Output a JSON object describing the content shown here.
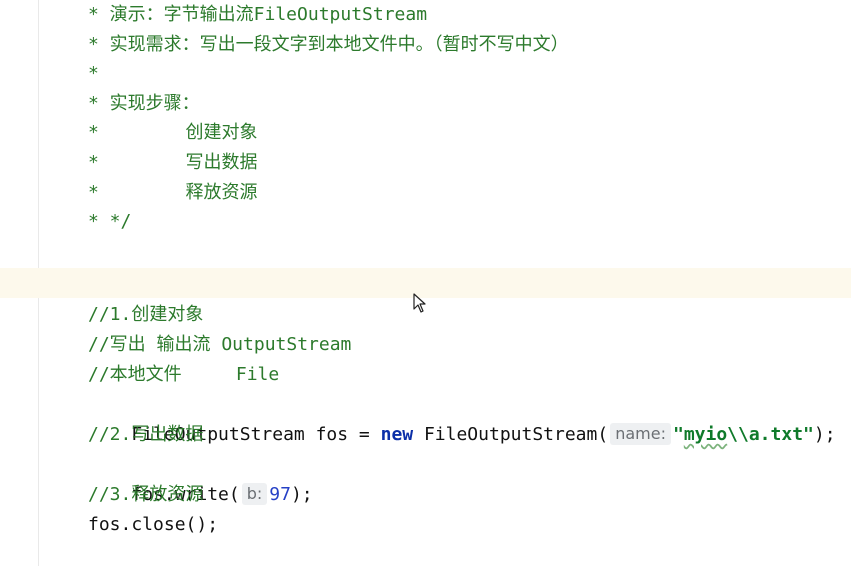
{
  "doc_comment": [
    "* 演示：字节输出流FileOutputStream",
    "* 实现需求：写出一段文字到本地文件中。（暂时不写中文）",
    "*",
    "* 实现步骤：",
    "*        创建对象",
    "*        写出数据",
    "*        释放资源",
    "* */"
  ],
  "code": {
    "comment_1": "//1.创建对象",
    "comment_2": "//写出 输出流 OutputStream",
    "comment_3": "//本地文件     File",
    "line_fos_type": "FileOutputStream fos = ",
    "line_fos_new": "new",
    "line_fos_ctor": " FileOutputStream(",
    "hint_name": "name:",
    "string_prefix": "\"",
    "string_path": "myio",
    "string_rest": "\\\\a.txt\"",
    "line_fos_end": ");",
    "comment_4": "//2.写出数据",
    "write_call": "fos.write(",
    "hint_b": "b:",
    "write_arg": "97",
    "write_end": ");",
    "comment_5": "//3.释放资源",
    "close_call": "fos.close();"
  }
}
